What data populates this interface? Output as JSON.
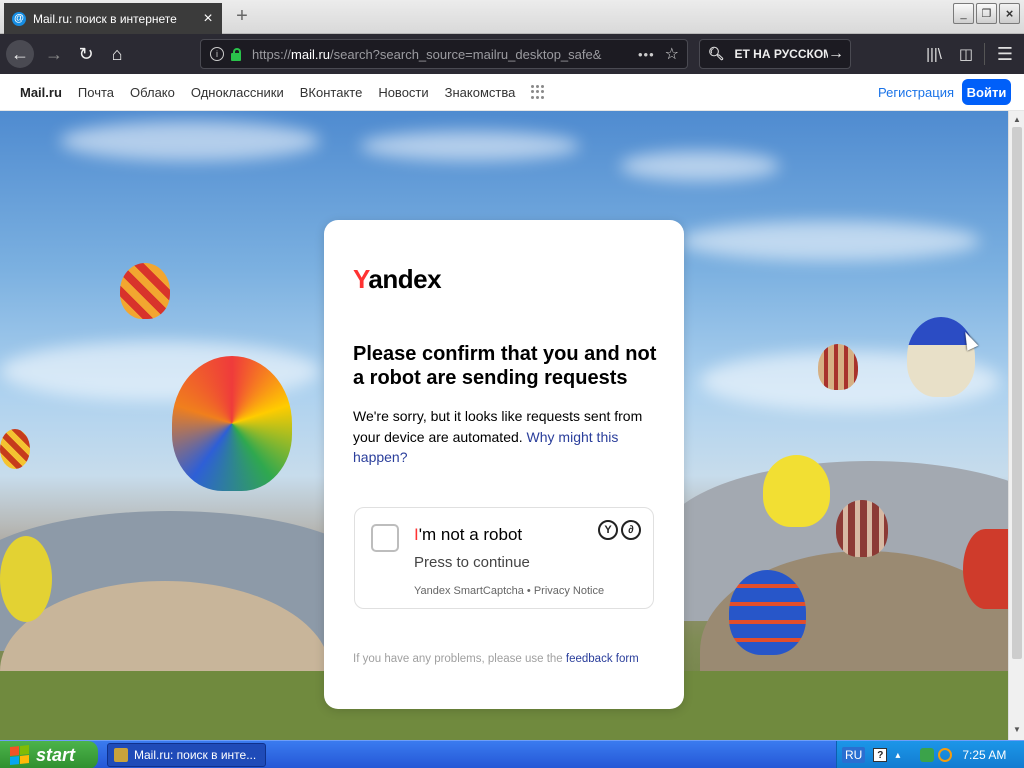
{
  "browser": {
    "tab_title": "Mail.ru: поиск в интернете",
    "tab_favicon": "@",
    "url_prefix": "https://",
    "url_domain": "mail.ru",
    "url_rest": "/search?search_source=mailru_desktop_safe&",
    "search_text": "ET НА РУССКОМ"
  },
  "portal": {
    "links": [
      "Mail.ru",
      "Почта",
      "Облако",
      "Одноклассники",
      "ВКонтакте",
      "Новости",
      "Знакомства"
    ],
    "register": "Регистрация",
    "login": "Войти"
  },
  "captcha": {
    "logo_y": "Y",
    "logo_rest": "andex",
    "heading": "Please confirm that you and not a robot are sending requests",
    "desc": "We're sorry, but it looks like requests sent from your device are automated.",
    "desc_link": "Why might this happen?",
    "checkbox_label_i": "I",
    "checkbox_label_rest": "'m not a robot",
    "checkbox_sub": "Press to continue",
    "legal": "Yandex SmartCaptcha • Privacy Notice",
    "footer_text": "If you have any problems, please use the",
    "footer_link": "feedback form"
  },
  "taskbar": {
    "start": "start",
    "task_item": "Mail.ru: поиск в инте...",
    "lang": "RU",
    "time": "7:25 AM"
  },
  "colors": {
    "accent_blue": "#005ff9",
    "yandex_red": "#ff3333",
    "link_blue": "#2a3e9b"
  }
}
